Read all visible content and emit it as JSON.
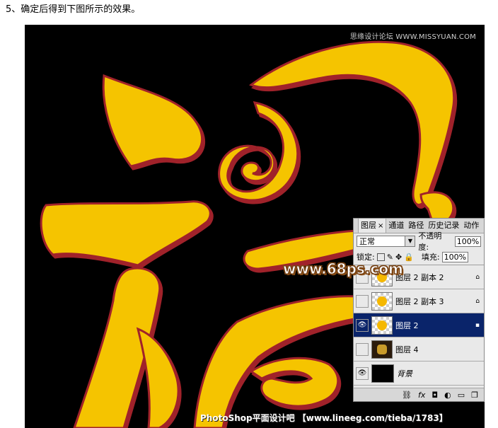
{
  "caption": "5、确定后得到下图所示的效果。",
  "watermarks": {
    "top": "思缘设计论坛 WWW.MISSYUAN.COM",
    "center": "www.68ps.com",
    "bottom": "PhotoShop平面设计吧 【www.lineeg.com/tieba/1783】"
  },
  "colors": {
    "canvas": "#000000",
    "glyph_fill": "#f5c400",
    "glyph_stroke": "#a0242a",
    "selection": "#0a246a"
  },
  "layers_panel": {
    "tabs": [
      {
        "label": "图层",
        "close": "×",
        "active": true
      },
      {
        "label": "通道"
      },
      {
        "label": "路径"
      },
      {
        "label": "历史记录"
      },
      {
        "label": "动作"
      }
    ],
    "blend_mode": "正常",
    "opacity_label": "不透明度:",
    "opacity_value": "100%",
    "lock_label": "锁定:",
    "fill_label": "填充:",
    "fill_value": "100%",
    "layers": [
      {
        "name": "图层 2 副本 2",
        "visible": false,
        "selected": false
      },
      {
        "name": "图层 2 副本 3",
        "visible": false,
        "selected": false
      },
      {
        "name": "图层 2",
        "visible": true,
        "selected": true
      },
      {
        "name": "图层 4",
        "visible": false,
        "selected": false
      },
      {
        "name": "背景",
        "visible": true,
        "selected": false
      }
    ],
    "bottom_icons": [
      "link-icon",
      "fx-icon",
      "mask-icon",
      "adjustment-icon",
      "folder-icon",
      "new-layer-icon"
    ]
  }
}
